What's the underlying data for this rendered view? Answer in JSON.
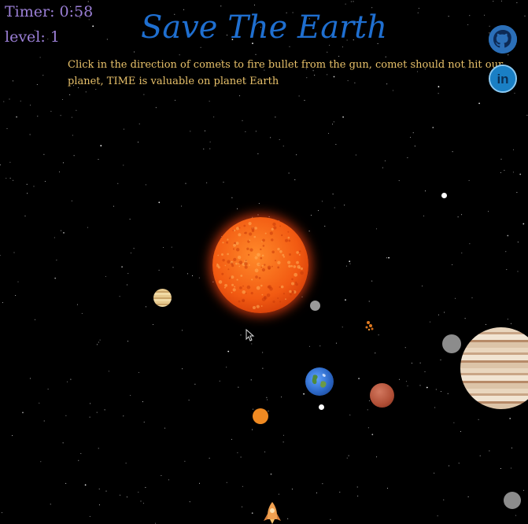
{
  "hud": {
    "timer_label": "Timer: 0:58",
    "level_label": "level: 1"
  },
  "title": "Save The Earth",
  "instructions": "Click in the direction of comets to fire bullet from the gun, comet should not hit our planet, TIME is valuable on planet Earth",
  "social": {
    "github_icon": "github-icon",
    "linkedin_icon": "linkedin-icon",
    "linkedin_text": "in"
  },
  "colors": {
    "background": "#000000",
    "title": "#1f6fd0",
    "instructions": "#e8c16a",
    "hud": "#9b7fd6"
  },
  "scene": {
    "sun": "sun",
    "planets": [
      "venus",
      "mercury",
      "earth",
      "mars",
      "jupiter"
    ],
    "comets": [
      "gray-comet",
      "gray-comet",
      "white-comet",
      "white-comet",
      "orange-comet"
    ],
    "player": "rocket-gun"
  }
}
